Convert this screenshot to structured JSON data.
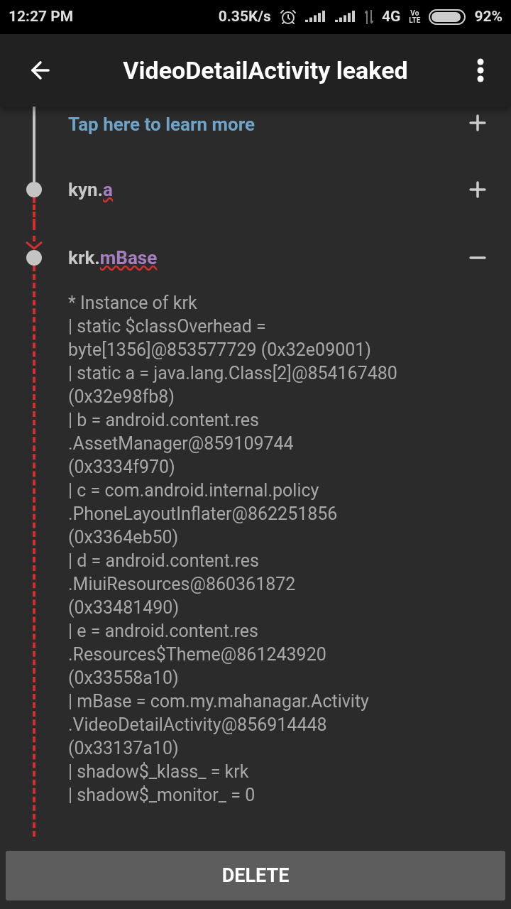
{
  "status_bar": {
    "time": "12:27 PM",
    "speed": "0.35K/s",
    "network": "4G",
    "volte_top": "Vo",
    "volte_bottom": "LTE",
    "battery": "92%"
  },
  "app_bar": {
    "title": "VideoDetailActivity leaked"
  },
  "nodes": [
    {
      "kind": "link",
      "text": "Tap here to learn more",
      "expanded": false,
      "dashed_below": false
    },
    {
      "kind": "reference",
      "class": "kyn.",
      "field": "a",
      "expanded": false,
      "dashed_below": true
    },
    {
      "kind": "reference",
      "class": "krk.",
      "field": "mBase",
      "expanded": true,
      "dashed_below": true,
      "details": [
        "* Instance of krk",
        "| static $classOverhead =",
        "byte[1356]@853577729 (0x32e09001)",
        "| static a = java.lang.Class[2]@854167480",
        "(0x32e98fb8)",
        "| b = android.content.res",
        ".AssetManager@859109744",
        "(0x3334f970)",
        "| c = com.android.internal.policy",
        ".PhoneLayoutInflater@862251856",
        "(0x3364eb50)",
        "| d = android.content.res",
        ".MiuiResources@860361872",
        "(0x33481490)",
        "| e = android.content.res",
        ".Resources$Theme@861243920",
        "(0x33558a10)",
        "| mBase = com.my.mahanagar.Activity",
        ".VideoDetailActivity@856914448",
        "(0x33137a10)",
        "| shadow$_klass_ = krk",
        "| shadow$_monitor_ = 0"
      ]
    }
  ],
  "button": "DELETE"
}
